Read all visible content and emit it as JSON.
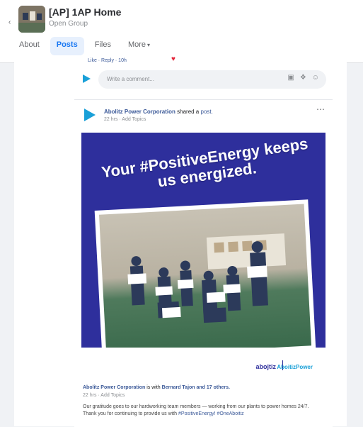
{
  "header": {
    "group_name": "[AP] 1AP Home",
    "group_type": "Open Group",
    "tabs": [
      {
        "label": "About"
      },
      {
        "label": "Posts"
      },
      {
        "label": "Files"
      },
      {
        "label": "More"
      }
    ]
  },
  "previous_comment": {
    "actions": "Like · Reply · 10h"
  },
  "comment_box": {
    "placeholder": "Write a comment..."
  },
  "post": {
    "author": "Abolitz Power Corporation",
    "action": "shared a",
    "action_link": "post.",
    "meta": "22 hrs · Add Topics",
    "image": {
      "headline": "Your #PositiveEnergy keeps us energized.",
      "brand_left": "abojtiz",
      "brand_right": "AboitizPower"
    },
    "caption": {
      "author": "Abolitz Power Corporation",
      "with_text": "is with",
      "tagged": "Bernard Tajon and 17 others.",
      "meta": "22 hrs · Add Topics",
      "body": "Our gratitude goes to our hardworking team members — working from our plants to power homes 24/7. Thank you for continuing to provide us with",
      "hashtags": "#PositiveEnergy! #OneAboitiz"
    }
  },
  "colors": {
    "accent": "#1877f2",
    "link": "#3b5998",
    "post_image_bg": "#2e2f9c",
    "reaction": "#e4263b"
  }
}
